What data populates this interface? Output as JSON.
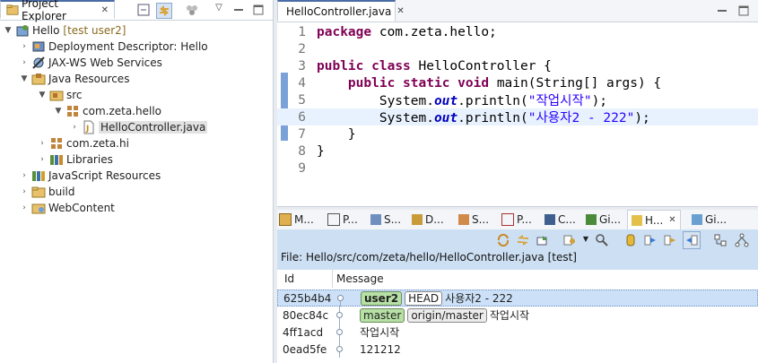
{
  "project_explorer": {
    "tab_label": "Project Explorer",
    "tree": [
      {
        "label": "Hello",
        "decoration": "[test user2]"
      },
      {
        "label": "Deployment Descriptor: Hello"
      },
      {
        "label": "JAX-WS Web Services"
      },
      {
        "label": "Java Resources"
      },
      {
        "label": "src"
      },
      {
        "label": "com.zeta.hello"
      },
      {
        "label": "HelloController.java"
      },
      {
        "label": "com.zeta.hi"
      },
      {
        "label": "Libraries"
      },
      {
        "label": "JavaScript Resources"
      },
      {
        "label": "build"
      },
      {
        "label": "WebContent"
      }
    ]
  },
  "editor": {
    "tab_label": "HelloController.java",
    "line_numbers": [
      "1",
      "2",
      "3",
      "4",
      "5",
      "6",
      "7",
      "8",
      "9"
    ],
    "code": {
      "l1_kw": "package",
      "l1_rest": " com.zeta.hello;",
      "l3_kw1": "public",
      "l3_kw2": "class",
      "l3_rest": " HelloController {",
      "l4_kw1": "public",
      "l4_kw2": "static",
      "l4_kw3": "void",
      "l4_rest": " main(String[] args) {",
      "l5_a": "System.",
      "l5_field": "out",
      "l5_b": ".println(",
      "l5_str": "\"작업시작\"",
      "l5_c": ");",
      "l6_a": "System.",
      "l6_field": "out",
      "l6_b": ".println(",
      "l6_str": "\"사용자2 - 222\"",
      "l6_c": ");",
      "l7": "}",
      "l8": "}"
    }
  },
  "bottom_tabs": [
    "M...",
    "P...",
    "S...",
    "D...",
    "S...",
    "P...",
    "C...",
    "Gi...",
    "H...",
    "Gi..."
  ],
  "history": {
    "file_label": "File: Hello/src/com/zeta/hello/HelloController.java [test]",
    "columns": {
      "id": "Id",
      "message": "Message"
    },
    "rows": [
      {
        "id": "625b4b4",
        "badges": [
          "user2",
          "HEAD"
        ],
        "message": "사용자2 - 222"
      },
      {
        "id": "80ec84c",
        "badges": [
          "master",
          "origin/master"
        ],
        "message": "작업시작"
      },
      {
        "id": "4ff1acd",
        "message": "작업시작"
      },
      {
        "id": "0ead5fe",
        "message": "121212"
      }
    ]
  },
  "colors": {
    "accent": "#4a6da8",
    "keyword": "#7f0055",
    "string": "#2a00ff",
    "history_bg": "#cde0f3"
  }
}
